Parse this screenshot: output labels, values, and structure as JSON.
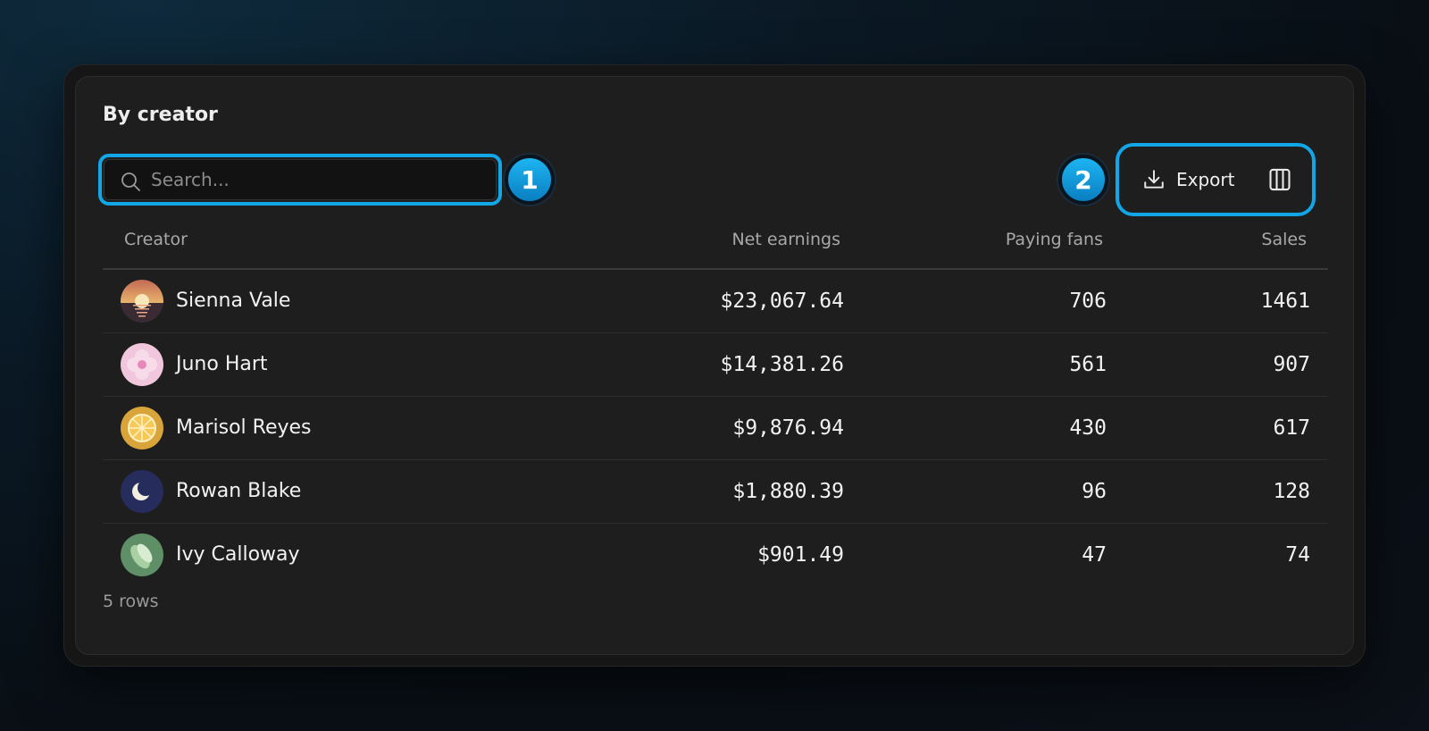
{
  "card": {
    "title": "By creator"
  },
  "search": {
    "placeholder": "Search..."
  },
  "badges": [
    "1",
    "2"
  ],
  "toolbar": {
    "export_label": "Export"
  },
  "table": {
    "columns": [
      "Creator",
      "Net earnings",
      "Paying fans",
      "Sales"
    ],
    "rows": [
      {
        "creator": "Sienna Vale",
        "net": "$23,067.64",
        "fans": "706",
        "sales": "1461",
        "avatar": "sunset-avatar"
      },
      {
        "creator": "Juno Hart",
        "net": "$14,381.26",
        "fans": "561",
        "sales": "907",
        "avatar": "flower-avatar"
      },
      {
        "creator": "Marisol Reyes",
        "net": "$9,876.94",
        "fans": "430",
        "sales": "617",
        "avatar": "citrus-avatar"
      },
      {
        "creator": "Rowan Blake",
        "net": "$1,880.39",
        "fans": "96",
        "sales": "128",
        "avatar": "moon-avatar"
      },
      {
        "creator": "Ivy Calloway",
        "net": "$901.49",
        "fans": "47",
        "sales": "74",
        "avatar": "leaf-avatar"
      }
    ]
  },
  "footer": {
    "row_count": "5 rows"
  },
  "colors": {
    "accent": "#13a6e6",
    "card_bg": "#1e1e1e",
    "text": "#f2f2f2",
    "muted": "#a8a8a8"
  }
}
